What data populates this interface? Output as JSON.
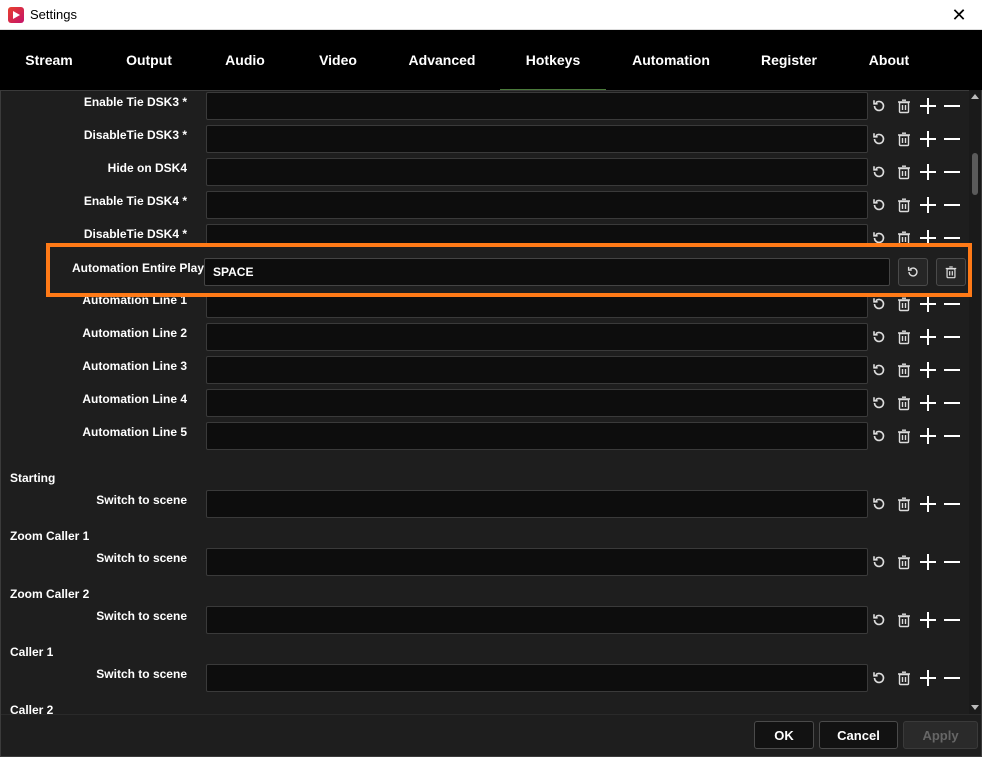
{
  "window": {
    "title": "Settings",
    "close_glyph": "✕"
  },
  "tabs": [
    {
      "label": "Stream"
    },
    {
      "label": "Output"
    },
    {
      "label": "Audio"
    },
    {
      "label": "Video"
    },
    {
      "label": "Advanced"
    },
    {
      "label": "Hotkeys",
      "active": true
    },
    {
      "label": "Automation"
    },
    {
      "label": "Register"
    },
    {
      "label": "About"
    }
  ],
  "hotkeys": {
    "rows": [
      {
        "label": "Enable Tie DSK3 *",
        "value": ""
      },
      {
        "label": "DisableTie DSK3 *",
        "value": ""
      },
      {
        "label": "Hide on DSK4",
        "value": ""
      },
      {
        "label": "Enable Tie DSK4 *",
        "value": ""
      },
      {
        "label": "DisableTie DSK4 *",
        "value": ""
      },
      {
        "label": "Automation Line 1",
        "value": ""
      },
      {
        "label": "Automation Line 2",
        "value": ""
      },
      {
        "label": "Automation Line 3",
        "value": ""
      },
      {
        "label": "Automation Line 4",
        "value": ""
      },
      {
        "label": "Automation Line 5",
        "value": ""
      }
    ],
    "sections": [
      {
        "name": "Starting",
        "row_label": "Switch to scene",
        "value": ""
      },
      {
        "name": "Zoom Caller 1",
        "row_label": "Switch to scene",
        "value": ""
      },
      {
        "name": "Zoom Caller 2",
        "row_label": "Switch to scene",
        "value": ""
      },
      {
        "name": "Caller 1",
        "row_label": "Switch to scene",
        "value": ""
      },
      {
        "name": "Caller 2",
        "row_label": "",
        "value": ""
      }
    ],
    "highlighted": {
      "label": "Automation Entire Play",
      "value": "SPACE"
    }
  },
  "icons": [
    "revert-icon",
    "trash-icon",
    "plus-icon",
    "minus-icon"
  ],
  "colors": {
    "highlight": "#ff7a17",
    "background": "#1e1e1e",
    "tabbar": "#000000"
  },
  "footer": {
    "ok": "OK",
    "cancel": "Cancel",
    "apply": "Apply"
  }
}
